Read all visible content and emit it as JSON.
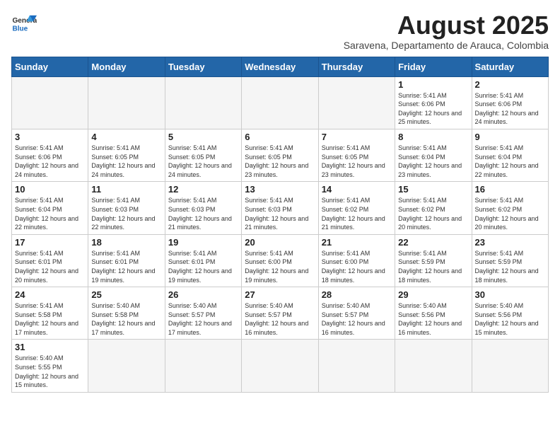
{
  "logo": {
    "text_general": "General",
    "text_blue": "Blue"
  },
  "header": {
    "title": "August 2025",
    "subtitle": "Saravena, Departamento de Arauca, Colombia"
  },
  "weekdays": [
    "Sunday",
    "Monday",
    "Tuesday",
    "Wednesday",
    "Thursday",
    "Friday",
    "Saturday"
  ],
  "weeks": [
    [
      {
        "day": "",
        "info": ""
      },
      {
        "day": "",
        "info": ""
      },
      {
        "day": "",
        "info": ""
      },
      {
        "day": "",
        "info": ""
      },
      {
        "day": "",
        "info": ""
      },
      {
        "day": "1",
        "info": "Sunrise: 5:41 AM\nSunset: 6:06 PM\nDaylight: 12 hours\nand 25 minutes."
      },
      {
        "day": "2",
        "info": "Sunrise: 5:41 AM\nSunset: 6:06 PM\nDaylight: 12 hours\nand 24 minutes."
      }
    ],
    [
      {
        "day": "3",
        "info": "Sunrise: 5:41 AM\nSunset: 6:06 PM\nDaylight: 12 hours\nand 24 minutes."
      },
      {
        "day": "4",
        "info": "Sunrise: 5:41 AM\nSunset: 6:05 PM\nDaylight: 12 hours\nand 24 minutes."
      },
      {
        "day": "5",
        "info": "Sunrise: 5:41 AM\nSunset: 6:05 PM\nDaylight: 12 hours\nand 24 minutes."
      },
      {
        "day": "6",
        "info": "Sunrise: 5:41 AM\nSunset: 6:05 PM\nDaylight: 12 hours\nand 23 minutes."
      },
      {
        "day": "7",
        "info": "Sunrise: 5:41 AM\nSunset: 6:05 PM\nDaylight: 12 hours\nand 23 minutes."
      },
      {
        "day": "8",
        "info": "Sunrise: 5:41 AM\nSunset: 6:04 PM\nDaylight: 12 hours\nand 23 minutes."
      },
      {
        "day": "9",
        "info": "Sunrise: 5:41 AM\nSunset: 6:04 PM\nDaylight: 12 hours\nand 22 minutes."
      }
    ],
    [
      {
        "day": "10",
        "info": "Sunrise: 5:41 AM\nSunset: 6:04 PM\nDaylight: 12 hours\nand 22 minutes."
      },
      {
        "day": "11",
        "info": "Sunrise: 5:41 AM\nSunset: 6:03 PM\nDaylight: 12 hours\nand 22 minutes."
      },
      {
        "day": "12",
        "info": "Sunrise: 5:41 AM\nSunset: 6:03 PM\nDaylight: 12 hours\nand 21 minutes."
      },
      {
        "day": "13",
        "info": "Sunrise: 5:41 AM\nSunset: 6:03 PM\nDaylight: 12 hours\nand 21 minutes."
      },
      {
        "day": "14",
        "info": "Sunrise: 5:41 AM\nSunset: 6:02 PM\nDaylight: 12 hours\nand 21 minutes."
      },
      {
        "day": "15",
        "info": "Sunrise: 5:41 AM\nSunset: 6:02 PM\nDaylight: 12 hours\nand 20 minutes."
      },
      {
        "day": "16",
        "info": "Sunrise: 5:41 AM\nSunset: 6:02 PM\nDaylight: 12 hours\nand 20 minutes."
      }
    ],
    [
      {
        "day": "17",
        "info": "Sunrise: 5:41 AM\nSunset: 6:01 PM\nDaylight: 12 hours\nand 20 minutes."
      },
      {
        "day": "18",
        "info": "Sunrise: 5:41 AM\nSunset: 6:01 PM\nDaylight: 12 hours\nand 19 minutes."
      },
      {
        "day": "19",
        "info": "Sunrise: 5:41 AM\nSunset: 6:01 PM\nDaylight: 12 hours\nand 19 minutes."
      },
      {
        "day": "20",
        "info": "Sunrise: 5:41 AM\nSunset: 6:00 PM\nDaylight: 12 hours\nand 19 minutes."
      },
      {
        "day": "21",
        "info": "Sunrise: 5:41 AM\nSunset: 6:00 PM\nDaylight: 12 hours\nand 18 minutes."
      },
      {
        "day": "22",
        "info": "Sunrise: 5:41 AM\nSunset: 5:59 PM\nDaylight: 12 hours\nand 18 minutes."
      },
      {
        "day": "23",
        "info": "Sunrise: 5:41 AM\nSunset: 5:59 PM\nDaylight: 12 hours\nand 18 minutes."
      }
    ],
    [
      {
        "day": "24",
        "info": "Sunrise: 5:41 AM\nSunset: 5:58 PM\nDaylight: 12 hours\nand 17 minutes."
      },
      {
        "day": "25",
        "info": "Sunrise: 5:40 AM\nSunset: 5:58 PM\nDaylight: 12 hours\nand 17 minutes."
      },
      {
        "day": "26",
        "info": "Sunrise: 5:40 AM\nSunset: 5:57 PM\nDaylight: 12 hours\nand 17 minutes."
      },
      {
        "day": "27",
        "info": "Sunrise: 5:40 AM\nSunset: 5:57 PM\nDaylight: 12 hours\nand 16 minutes."
      },
      {
        "day": "28",
        "info": "Sunrise: 5:40 AM\nSunset: 5:57 PM\nDaylight: 12 hours\nand 16 minutes."
      },
      {
        "day": "29",
        "info": "Sunrise: 5:40 AM\nSunset: 5:56 PM\nDaylight: 12 hours\nand 16 minutes."
      },
      {
        "day": "30",
        "info": "Sunrise: 5:40 AM\nSunset: 5:56 PM\nDaylight: 12 hours\nand 15 minutes."
      }
    ],
    [
      {
        "day": "31",
        "info": "Sunrise: 5:40 AM\nSunset: 5:55 PM\nDaylight: 12 hours\nand 15 minutes."
      },
      {
        "day": "",
        "info": ""
      },
      {
        "day": "",
        "info": ""
      },
      {
        "day": "",
        "info": ""
      },
      {
        "day": "",
        "info": ""
      },
      {
        "day": "",
        "info": ""
      },
      {
        "day": "",
        "info": ""
      }
    ]
  ]
}
